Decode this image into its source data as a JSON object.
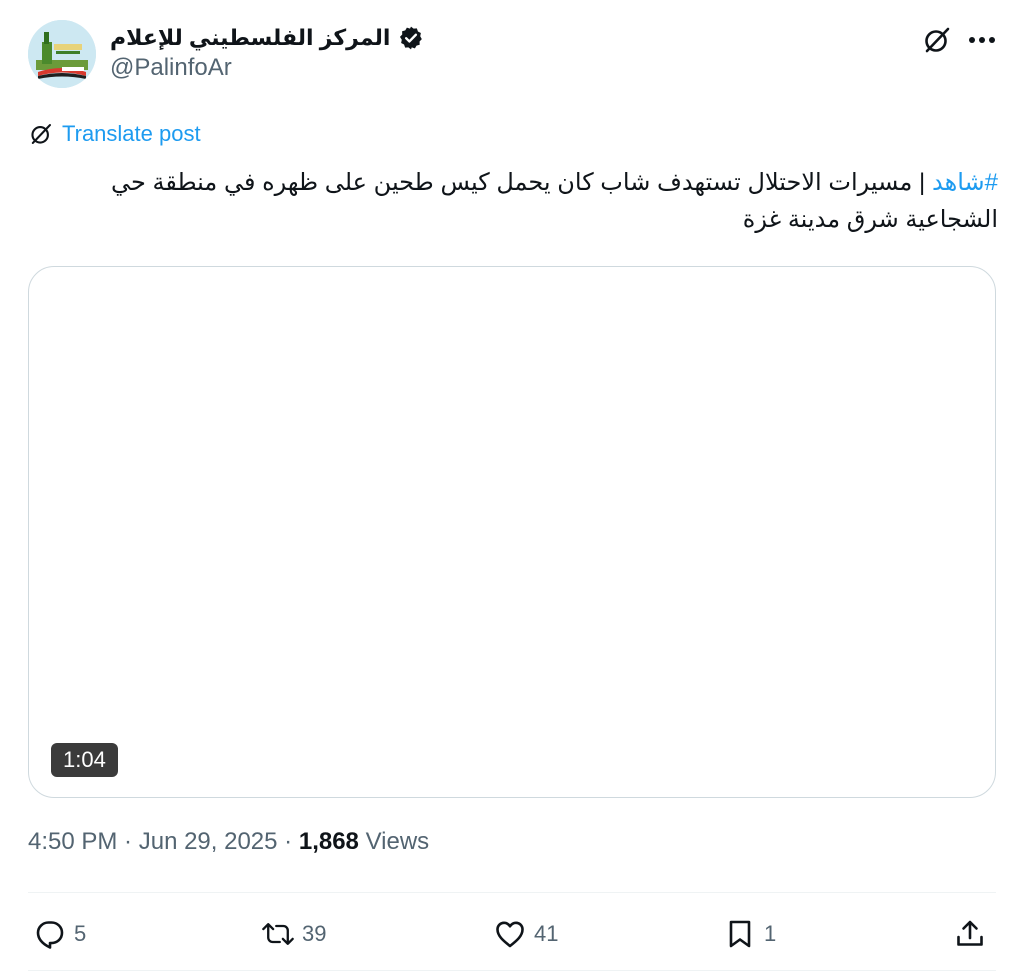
{
  "author": {
    "display_name": "المركز الفلسطيني للإعلام",
    "handle": "@PalinfoAr",
    "verified": true,
    "avatar_icon": "palinfo-logo-avatar"
  },
  "header": {
    "grok_icon": "grok-icon",
    "more_icon": "more-icon"
  },
  "translate": {
    "label": "Translate post",
    "icon": "grok-icon"
  },
  "tweet": {
    "hashtag": "#شاهد",
    "body": " | مسيرات الاحتلال تستهدف شاب كان يحمل كيس طحين على ظهره في منطقة حي الشجاعية شرق مدينة غزة"
  },
  "media": {
    "type": "video",
    "duration": "1:04"
  },
  "meta": {
    "time": "4:50 PM",
    "separator": " · ",
    "date": "Jun 29, 2025",
    "views_count": "1,868",
    "views_label": "Views"
  },
  "actions": {
    "reply_count": "5",
    "retweet_count": "39",
    "like_count": "41",
    "bookmark_count": "1"
  },
  "colors": {
    "accent": "#1d9bf0",
    "text_primary": "#0f1419",
    "text_secondary": "#536471",
    "border": "#cfd9de"
  }
}
